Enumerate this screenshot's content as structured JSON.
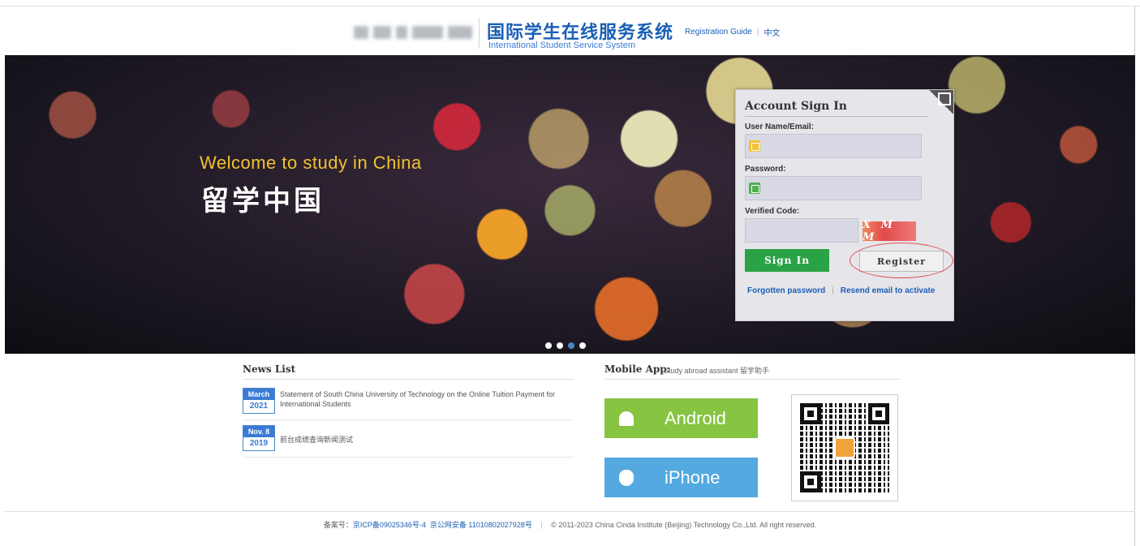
{
  "header": {
    "title_cn": "国际学生在线服务系统",
    "title_en": "International Student Service System",
    "links": [
      "Registration Guide",
      "中文"
    ]
  },
  "hero": {
    "welcome": "Welcome to  study  in China",
    "title_cn": "留学中国",
    "carousel_dots": 4,
    "active_dot": 3
  },
  "login": {
    "title": "Account Sign In",
    "username_label": "User Name/Email:",
    "password_label": "Password:",
    "code_label": "Verified Code:",
    "captcha": "X M M",
    "signin": "Sign In",
    "register": "Register",
    "forgot": "Forgotten password",
    "resend": "Resend email to activate"
  },
  "news": {
    "title": "News List",
    "items": [
      {
        "month": "March",
        "year": "2021",
        "text": "Statement of South China University of Technology on the Online Tuition Payment for International Students"
      },
      {
        "month": "Nov. 8",
        "year": "2019",
        "text": "前台成绩查询新闻测试"
      }
    ]
  },
  "mobile": {
    "title": "Mobile App:",
    "subtitle": "Study abroad assistant  留学助手",
    "android": "Android",
    "iphone": "iPhone"
  },
  "footer": {
    "record_label": "备案号：",
    "icp": "京ICP备09025346号-4",
    "police": "京公网安备 11010802027928号",
    "copyright": "© 2011-2023 China Cinda Institute (Beijing) Technology Co.,Ltd. All right reserved."
  },
  "colors": {
    "brand_blue": "#1a5fb4",
    "signin_green": "#2aa346",
    "android_green": "#86c442",
    "iphone_blue": "#53a9e0",
    "welcome_yellow": "#f2c230"
  }
}
